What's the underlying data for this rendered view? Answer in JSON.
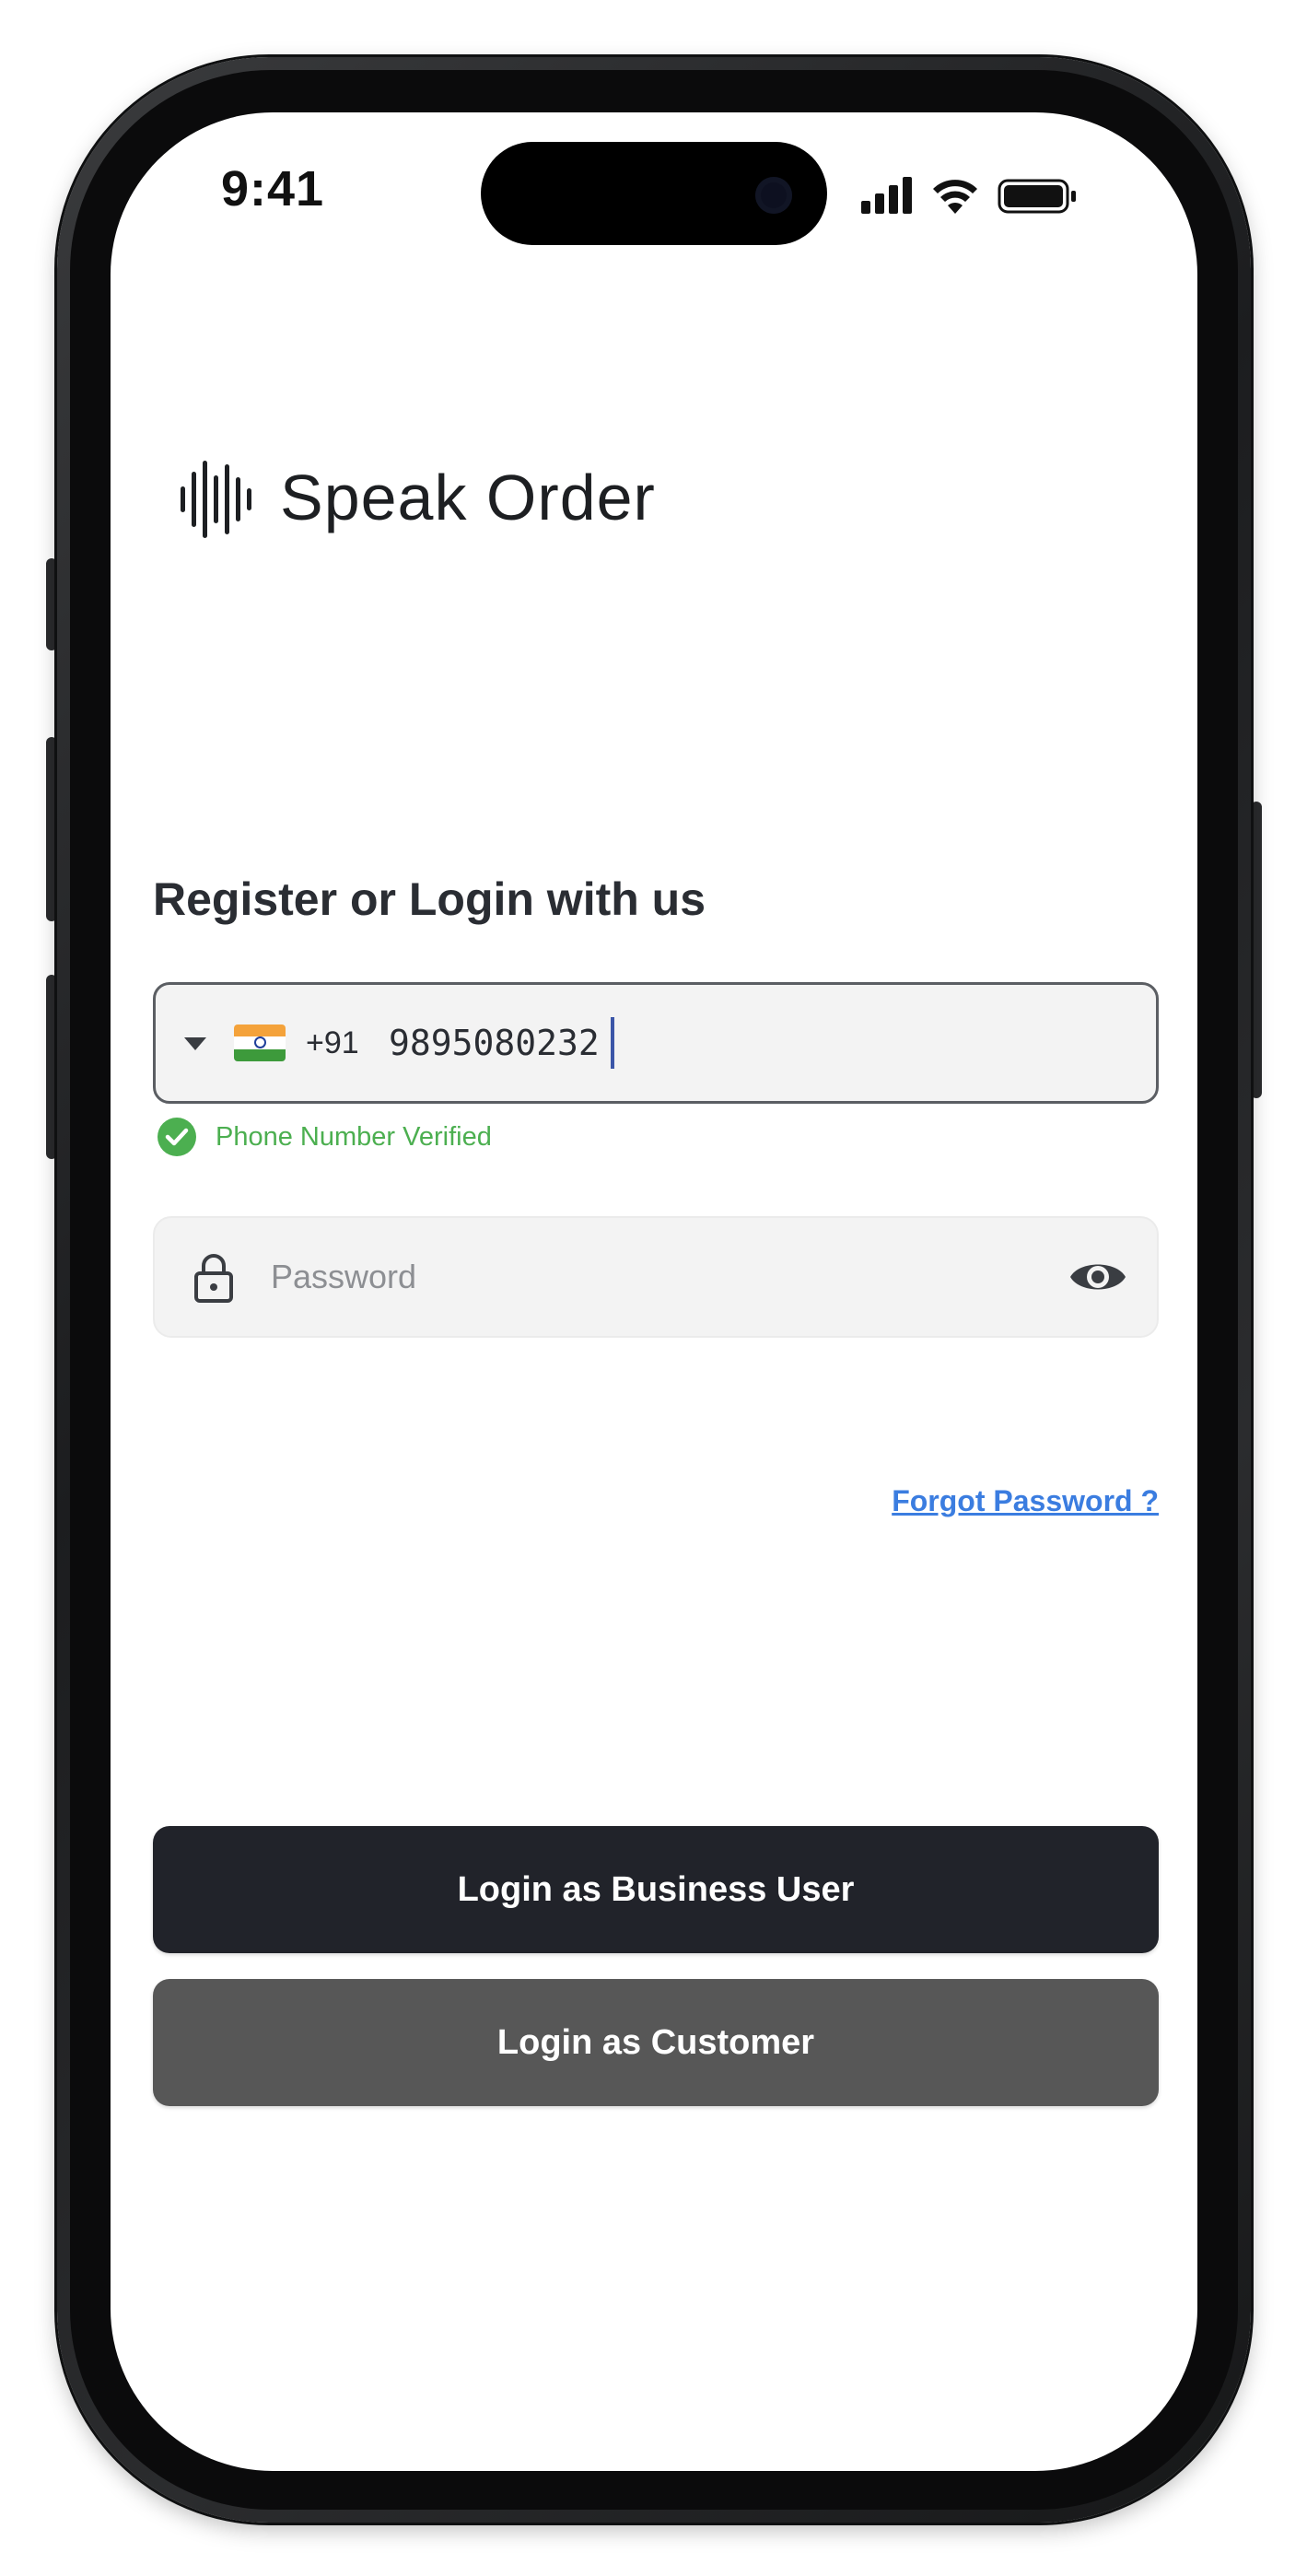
{
  "status_bar": {
    "time": "9:41"
  },
  "app": {
    "name": "Speak Order",
    "logo_icon": "soundwave-logo-icon"
  },
  "login": {
    "heading": "Register or Login with us",
    "phone": {
      "country_flag": "india-flag-icon",
      "dial_code": "+91",
      "value": "9895080232",
      "verified_text": "Phone Number Verified"
    },
    "password": {
      "placeholder": "Password",
      "value": ""
    },
    "forgot_label": "Forgot Password ?",
    "business_button": "Login as Business User",
    "customer_button": "Login as Customer"
  },
  "colors": {
    "primary_button": "#21232a",
    "secondary_button": "#575757",
    "verified": "#4caf50",
    "link": "#3b7de0"
  }
}
